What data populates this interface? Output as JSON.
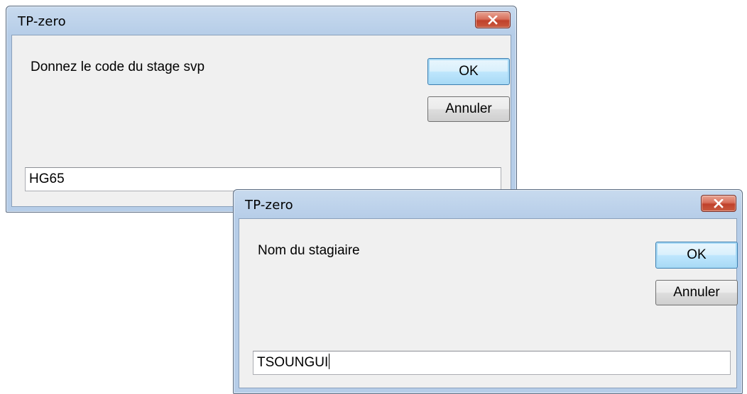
{
  "dialogs": [
    {
      "title": "TP-zero",
      "prompt": "Donnez le code du stage svp",
      "ok_label": "OK",
      "cancel_label": "Annuler",
      "input_value": "HG65",
      "focused": false
    },
    {
      "title": "TP-zero",
      "prompt": "Nom du stagiaire",
      "ok_label": "OK",
      "cancel_label": "Annuler",
      "input_value": "TSOUNGUI",
      "focused": true
    }
  ],
  "icons": {
    "close": "close-icon"
  },
  "colors": {
    "titlebar": "#bfd4ec",
    "client_bg": "#f0f0f0",
    "close_button": "#c95a3f",
    "default_button_border": "#3c7fb1"
  }
}
